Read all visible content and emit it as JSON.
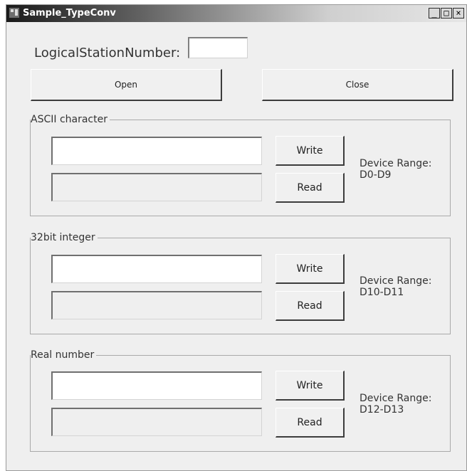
{
  "window": {
    "title": "Sample_TypeConv",
    "controls": {
      "minimize": "_",
      "maximize": "□",
      "close": "×"
    }
  },
  "station": {
    "label": "LogicalStationNumber:",
    "value": ""
  },
  "buttons": {
    "open": "Open",
    "close": "Close"
  },
  "groups": [
    {
      "title": "ASCII character",
      "write_label": "Write",
      "read_label": "Read",
      "range_label": "Device Range:",
      "range_value": "D0-D9",
      "write_value": "",
      "read_value": ""
    },
    {
      "title": "32bit integer",
      "write_label": "Write",
      "read_label": "Read",
      "range_label": "Device Range:",
      "range_value": "D10-D11",
      "write_value": "",
      "read_value": ""
    },
    {
      "title": "Real number",
      "write_label": "Write",
      "read_label": "Read",
      "range_label": "Device Range:",
      "range_value": "D12-D13",
      "write_value": "",
      "read_value": ""
    }
  ]
}
